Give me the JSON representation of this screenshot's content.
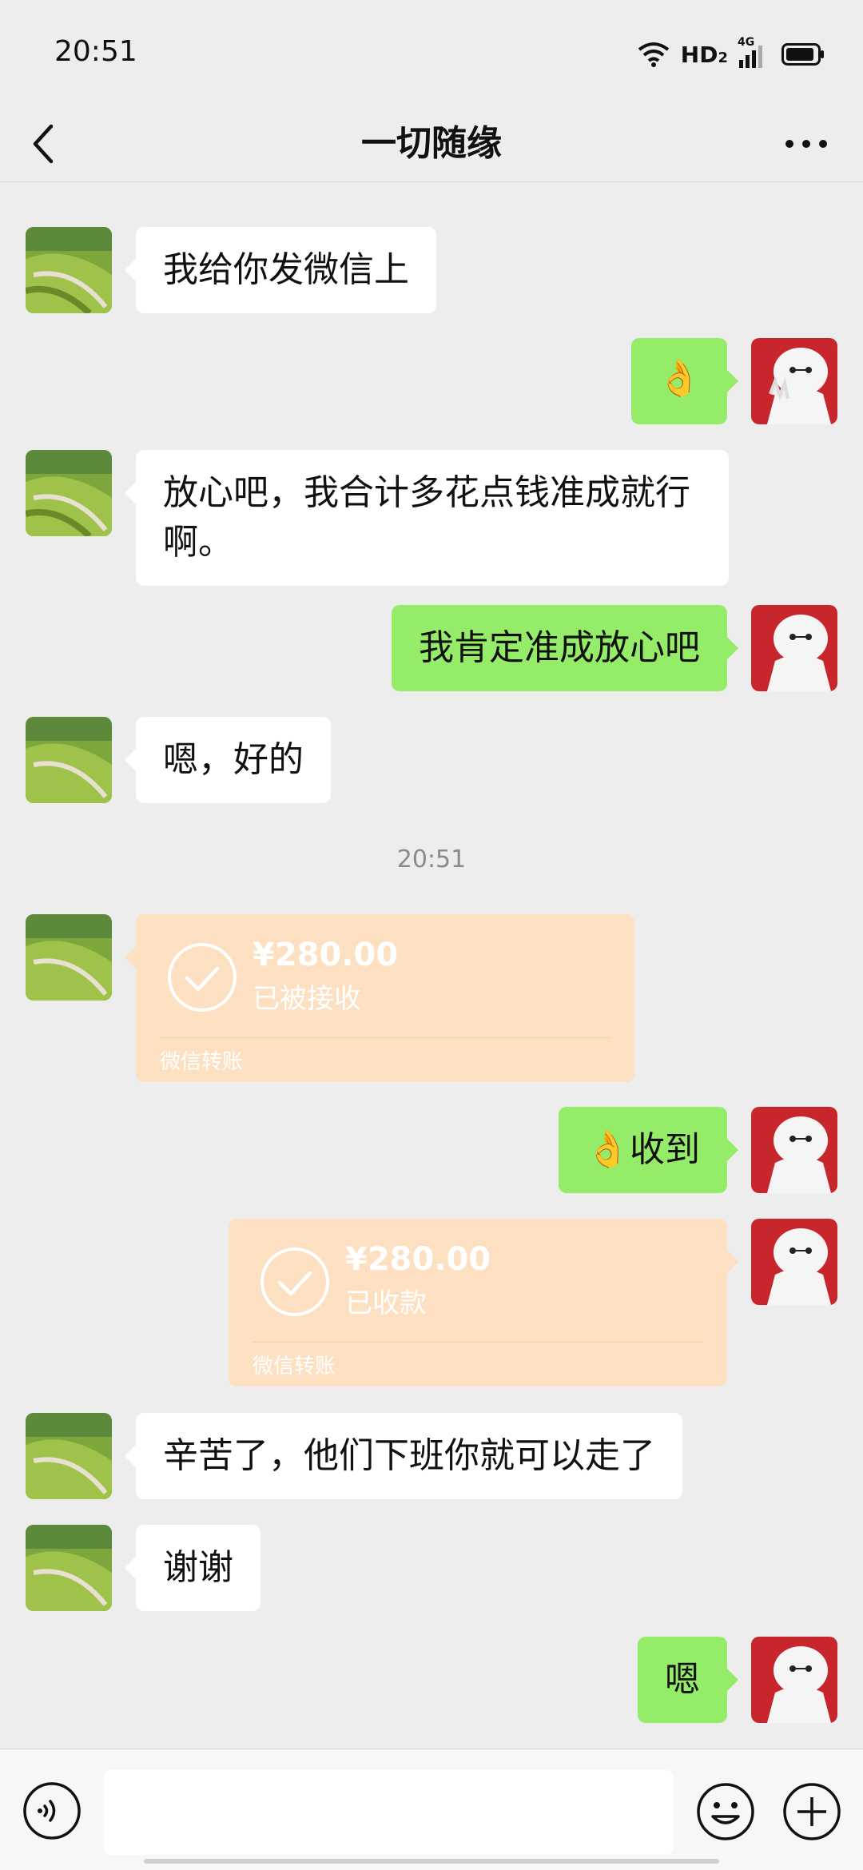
{
  "status_bar": {
    "time": "20:51",
    "network": "HD",
    "network_sub": "2",
    "cell": "4G"
  },
  "header": {
    "title": "一切随缘"
  },
  "messages": [
    {
      "text": "我给你发微信上"
    },
    {
      "text": "👌"
    },
    {
      "line1": "放心吧，我合计多花点钱准成就行",
      "line2": "啊。"
    },
    {
      "text": "我肯定准成放心吧"
    },
    {
      "text": "嗯，好的"
    },
    {
      "time": "20:51"
    },
    {
      "amount": "¥280.00",
      "status": "已被接收",
      "footer": "微信转账"
    },
    {
      "text": "👌收到"
    },
    {
      "amount": "¥280.00",
      "status": "已收款",
      "footer": "微信转账"
    },
    {
      "text": "辛苦了，他们下班你就可以走了"
    },
    {
      "text": "谢谢"
    },
    {
      "text": "嗯"
    }
  ],
  "colors": {
    "background": "#ededed",
    "sent_bubble": "#95ec69",
    "received_bubble": "#ffffff",
    "transfer_card": "#fce0c1"
  },
  "icons": [
    "back-arrow-icon",
    "more-icon",
    "voice-icon",
    "emoji-icon",
    "plus-icon",
    "check-circle-icon",
    "wifi-icon",
    "signal-icon",
    "battery-icon"
  ]
}
